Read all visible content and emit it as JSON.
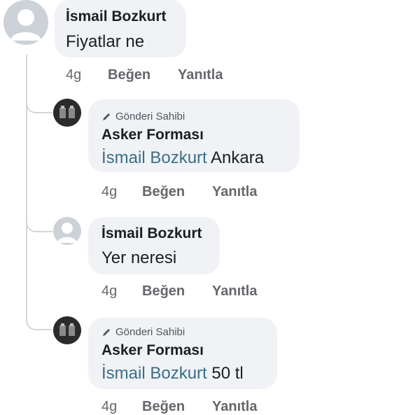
{
  "comments": [
    {
      "author": "İsmail Bozkurt",
      "text": "Fiyatlar ne",
      "actions": {
        "time": "4g",
        "like": "Beğen",
        "reply": "Yanıtla"
      }
    },
    {
      "badge": "Gönderi Sahibi",
      "author": "Asker Forması",
      "mention": "İsmail Bozkurt",
      "text": "Ankara",
      "actions": {
        "time": "4g",
        "like": "Beğen",
        "reply": "Yanıtla"
      }
    },
    {
      "author": "İsmail Bozkurt",
      "text": "Yer neresi",
      "actions": {
        "time": "4g",
        "like": "Beğen",
        "reply": "Yanıtla"
      }
    },
    {
      "badge": "Gönderi Sahibi",
      "author": "Asker Forması",
      "mention": "İsmail Bozkurt",
      "text": "50 tl",
      "actions": {
        "time": "4g",
        "like": "Beğen",
        "reply": "Yanıtla"
      }
    }
  ]
}
